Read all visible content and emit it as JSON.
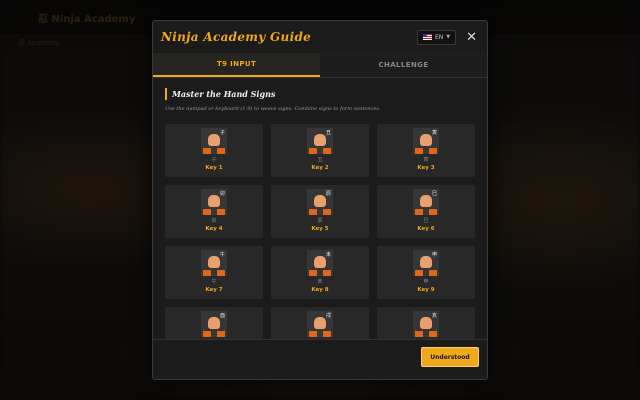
{
  "background": {
    "logo_text": "忍 Ninja Academy",
    "subtitle": "忍 Academy"
  },
  "modal": {
    "title": "Ninja Academy Guide",
    "language": {
      "flag": "us-flag",
      "selected": "EN"
    },
    "close_icon": "close-icon",
    "tabs": [
      {
        "label": "T9 INPUT",
        "active": true
      },
      {
        "label": "CHALLENGE",
        "active": false
      }
    ],
    "section_title": "Master the Hand Signs",
    "description": "Use the numpad or keyboard (1-9) to weave signs. Combine signs to form sentences.",
    "signs": [
      {
        "key": "Key 1",
        "kanji": "子",
        "mini": "子"
      },
      {
        "key": "Key 2",
        "kanji": "丑",
        "mini": "丑"
      },
      {
        "key": "Key 3",
        "kanji": "寅",
        "mini": "寅"
      },
      {
        "key": "Key 4",
        "kanji": "卯",
        "mini": "卯"
      },
      {
        "key": "Key 5",
        "kanji": "辰",
        "mini": "辰"
      },
      {
        "key": "Key 6",
        "kanji": "巳",
        "mini": "巳"
      },
      {
        "key": "Key 7",
        "kanji": "午",
        "mini": "午"
      },
      {
        "key": "Key 8",
        "kanji": "未",
        "mini": "未"
      },
      {
        "key": "Key 9",
        "kanji": "申",
        "mini": "申"
      },
      {
        "key": "",
        "kanji": "酉",
        "mini": ""
      },
      {
        "key": "",
        "kanji": "戌",
        "mini": ""
      },
      {
        "key": "",
        "kanji": "亥",
        "mini": ""
      }
    ],
    "confirm_label": "Understood"
  },
  "colors": {
    "accent": "#f0a81c",
    "modal_bg": "#1b1b1b",
    "card_bg": "#282828",
    "sleeve": "#e0661c",
    "skin": "#e8a070"
  }
}
